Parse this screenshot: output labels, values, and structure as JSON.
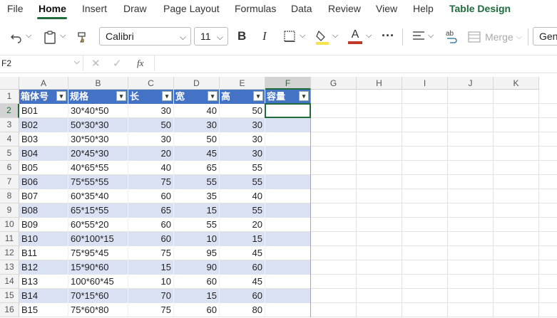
{
  "menu": [
    "File",
    "Home",
    "Insert",
    "Draw",
    "Page Layout",
    "Formulas",
    "Data",
    "Review",
    "View",
    "Help",
    "Table Design"
  ],
  "ribbon": {
    "font_name": "Calibri",
    "font_size": "11",
    "bold": "B",
    "italic": "I",
    "font_color_letter": "A",
    "more": "···",
    "merge_label": "Merge",
    "number_format": "Gen",
    "highlight_color": "#f5e44a",
    "font_color": "#c0392b"
  },
  "formula_bar": {
    "name_box": "F2",
    "fx": "fx",
    "content": ""
  },
  "columns": [
    "A",
    "B",
    "C",
    "D",
    "E",
    "F",
    "G",
    "H",
    "I",
    "J",
    "K"
  ],
  "selected_column": "F",
  "selected_row": "2",
  "table": {
    "headers": [
      "箱体号",
      "规格",
      "长",
      "宽",
      "高",
      "容量"
    ],
    "rows": [
      [
        "B01",
        "30*40*50",
        "30",
        "40",
        "50",
        ""
      ],
      [
        "B02",
        "50*30*30",
        "50",
        "30",
        "30",
        ""
      ],
      [
        "B03",
        "30*50*30",
        "30",
        "50",
        "30",
        ""
      ],
      [
        "B04",
        "20*45*30",
        "20",
        "45",
        "30",
        ""
      ],
      [
        "B05",
        "40*65*55",
        "40",
        "65",
        "55",
        ""
      ],
      [
        "B06",
        "75*55*55",
        "75",
        "55",
        "55",
        ""
      ],
      [
        "B07",
        "60*35*40",
        "60",
        "35",
        "40",
        ""
      ],
      [
        "B08",
        "65*15*55",
        "65",
        "15",
        "55",
        ""
      ],
      [
        "B09",
        "60*55*20",
        "60",
        "55",
        "20",
        ""
      ],
      [
        "B10",
        "60*100*15",
        "60",
        "10",
        "15",
        ""
      ],
      [
        "B11",
        "75*95*45",
        "75",
        "95",
        "45",
        ""
      ],
      [
        "B12",
        "15*90*60",
        "15",
        "90",
        "60",
        ""
      ],
      [
        "B13",
        "100*60*45",
        "10",
        "60",
        "45",
        ""
      ],
      [
        "B14",
        "70*15*60",
        "70",
        "15",
        "60",
        ""
      ],
      [
        "B15",
        "75*60*80",
        "75",
        "60",
        "80",
        ""
      ]
    ]
  }
}
